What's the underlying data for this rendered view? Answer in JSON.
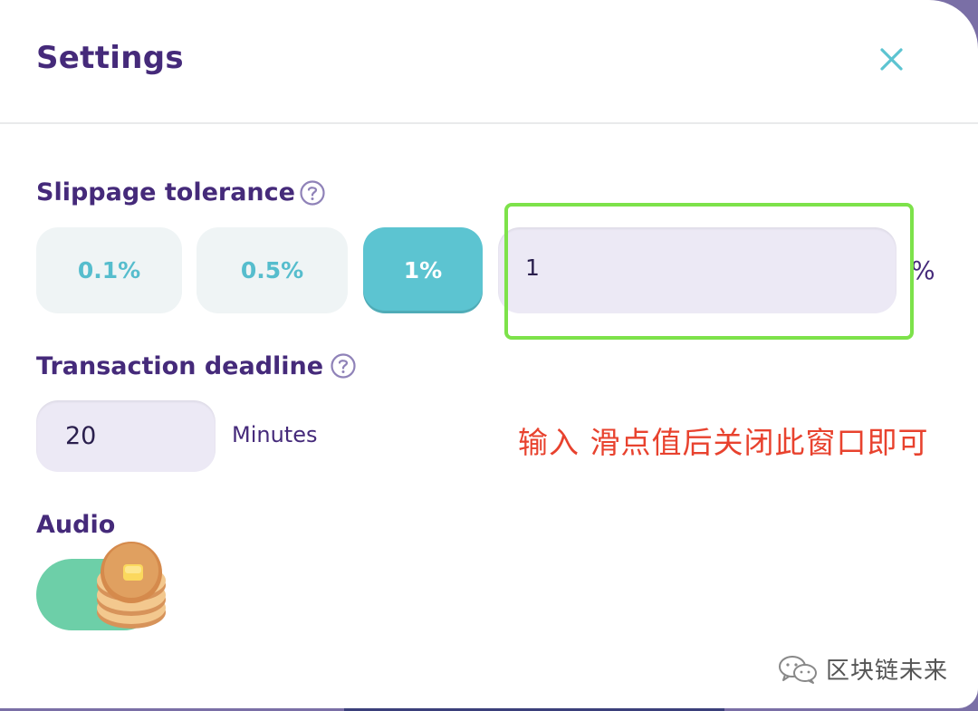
{
  "dialog": {
    "title": "Settings",
    "close_icon": "close-icon"
  },
  "slippage": {
    "label": "Slippage tolerance",
    "help_icon": "question-circle-icon",
    "presets": [
      {
        "label": "0.1%",
        "active": false
      },
      {
        "label": "0.5%",
        "active": false
      },
      {
        "label": "1%",
        "active": true
      }
    ],
    "custom_value": "1",
    "unit": "%"
  },
  "deadline": {
    "label": "Transaction deadline",
    "help_icon": "question-circle-icon",
    "value": "20",
    "unit": "Minutes"
  },
  "audio": {
    "label": "Audio",
    "enabled": true,
    "thumb_icon": "pancake-icon"
  },
  "annotation": {
    "text": "输入 滑点值后关闭此窗口即可"
  },
  "watermark": {
    "icon": "wechat-icon",
    "text": "区块链未来"
  },
  "colors": {
    "title": "#452a7a",
    "accent": "#5cc4d1",
    "preset_text": "#56bdcd",
    "input_bg": "#ece9f5",
    "toggle_on": "#6dcfa8",
    "highlight": "#7de24a",
    "annotation": "#e8422e"
  }
}
